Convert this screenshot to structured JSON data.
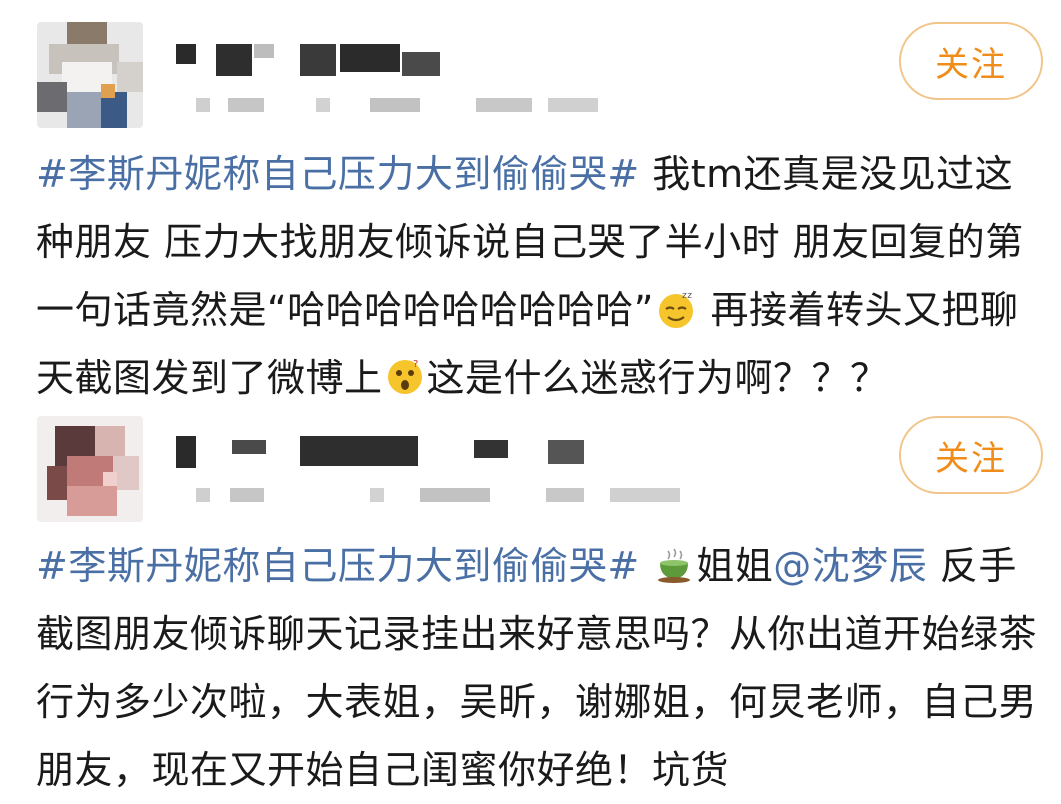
{
  "posts": [
    {
      "follow_label": "关注",
      "topic": "#李斯丹妮称自己压力大到偷偷哭#",
      "segments": {
        "a": " 我tm还真是没见过这种朋友 压力大找朋友倾诉说自己哭了半小时 朋友回复的第一句话竟然是“哈哈哈哈哈哈哈哈哈”",
        "b": " 再接着转头又把聊天截图发到了微博上",
        "c": "这是什么迷惑行为啊？？？"
      },
      "emojis": [
        "tired-smile-emoji",
        "surprised-emoji"
      ]
    },
    {
      "follow_label": "关注",
      "topic": "#李斯丹妮称自己压力大到偷偷哭#",
      "segments": {
        "a": " ",
        "b": "姐姐",
        "mention": "@沈梦辰",
        "c": " 反手截图朋友倾诉聊天记录挂出来好意思吗？从你出道开始绿茶行为多少次啦，大表姐，吴昕，谢娜姐，何炅老师，自己男朋友，现在又开始自己闺蜜你好绝！坑货"
      },
      "emojis": [
        "tea-cup-emoji"
      ]
    }
  ],
  "colors": {
    "topic": "#4a6fa5",
    "follow_border": "#f2c58a",
    "follow_text": "#f08c1a",
    "body_text": "#1a1a1a"
  }
}
